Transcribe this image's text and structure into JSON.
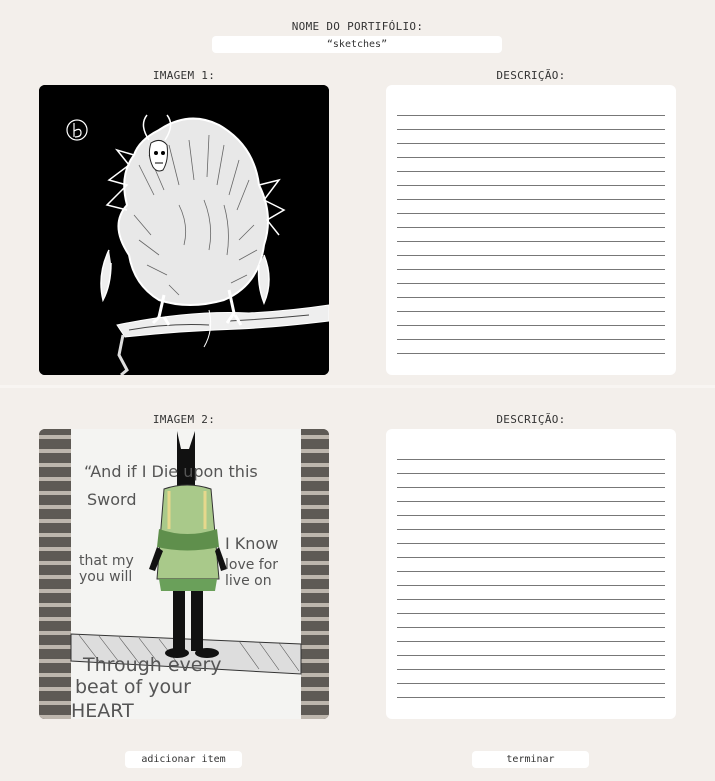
{
  "portfolio": {
    "title_label": "NOME DO PORTIFÓLIO:",
    "name_value": "“sketches”"
  },
  "items": [
    {
      "image_label": "IMAGEM 1:",
      "description_label": "DESCRIÇÃO:",
      "description_value": ""
    },
    {
      "image_label": "IMAGEM 2:",
      "description_label": "DESCRIÇÃO:",
      "description_value": "",
      "artwork_text": {
        "line1": "“And if I Die upon this",
        "line2": "Sword",
        "line3": "I Know",
        "line4": "that my",
        "line5": "love for",
        "line6": "you will",
        "line7": "live on",
        "line8": "Through every",
        "line9": "beat of your",
        "line10": "HEART"
      }
    }
  ],
  "actions": {
    "add_item_label": "adicionar item",
    "finish_label": "terminar"
  },
  "colors": {
    "page_background": "#f3efeb",
    "panel_background": "#ffffff",
    "text": "#333333"
  }
}
